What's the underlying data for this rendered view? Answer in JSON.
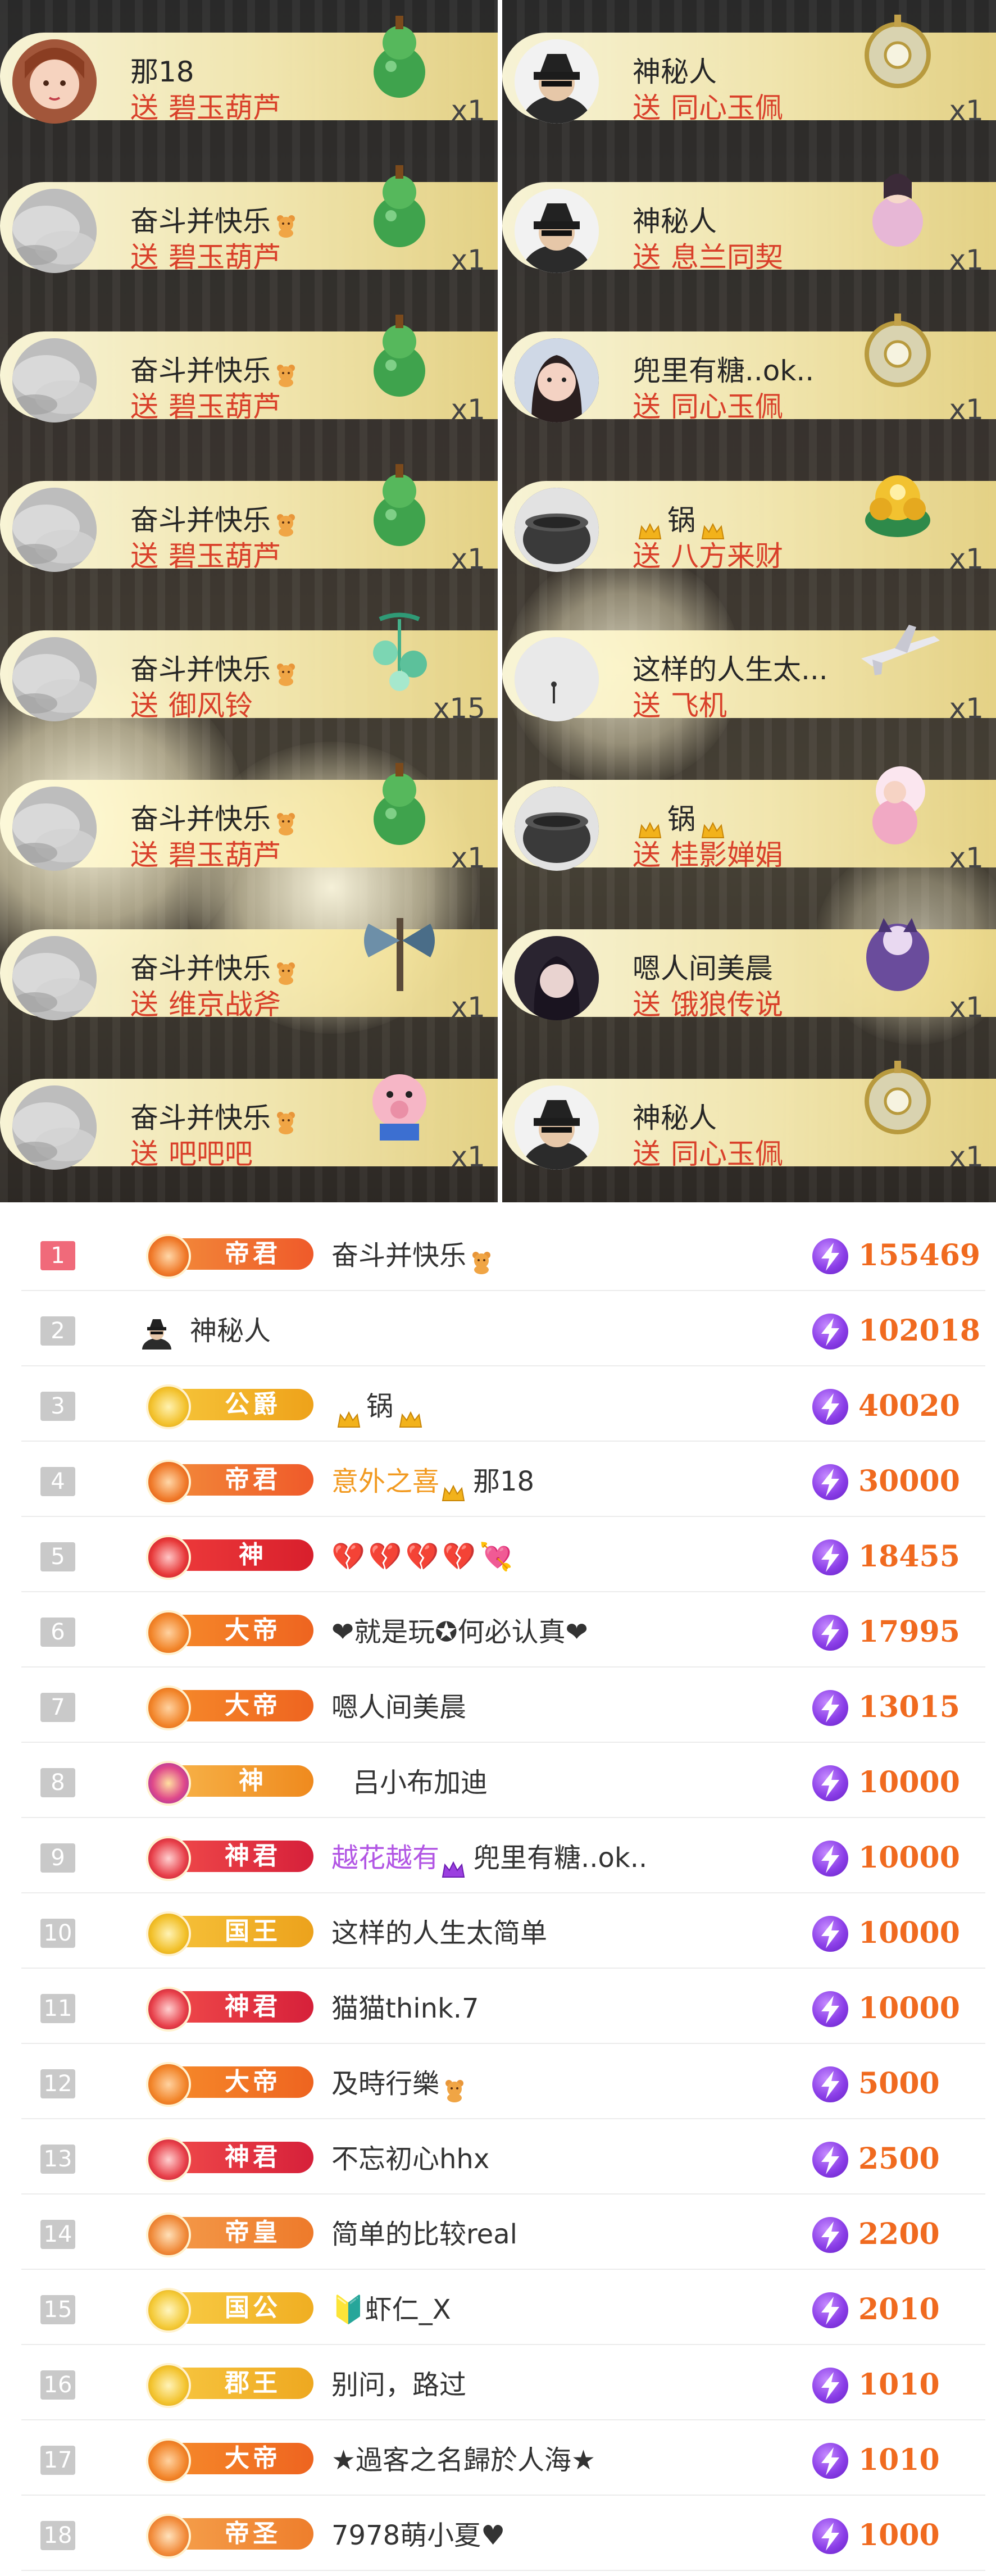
{
  "gift_feed": {
    "send_word": "送",
    "left": [
      {
        "name": "那18",
        "gift": "碧玉葫芦",
        "count": "x1",
        "avatar": "girl",
        "icon": "jade-gourd-icon",
        "bear": false
      },
      {
        "name": "奋斗并快乐",
        "gift": "碧玉葫芦",
        "count": "x1",
        "avatar": "mist",
        "icon": "jade-gourd-icon",
        "bear": true
      },
      {
        "name": "奋斗并快乐",
        "gift": "碧玉葫芦",
        "count": "x1",
        "avatar": "mist",
        "icon": "jade-gourd-icon",
        "bear": true
      },
      {
        "name": "奋斗并快乐",
        "gift": "碧玉葫芦",
        "count": "x1",
        "avatar": "mist",
        "icon": "jade-gourd-icon",
        "bear": true
      },
      {
        "name": "奋斗并快乐",
        "gift": "御风铃",
        "count": "x15",
        "avatar": "mist",
        "icon": "wind-chime-icon",
        "bear": true
      },
      {
        "name": "奋斗并快乐",
        "gift": "碧玉葫芦",
        "count": "x1",
        "avatar": "mist",
        "icon": "jade-gourd-icon",
        "bear": true
      },
      {
        "name": "奋斗并快乐",
        "gift": "维京战斧",
        "count": "x1",
        "avatar": "mist",
        "icon": "viking-axe-icon",
        "bear": true
      },
      {
        "name": "奋斗并快乐",
        "gift": "吧吧吧",
        "count": "x1",
        "avatar": "mist",
        "icon": "cartoon-pig-icon",
        "bear": true
      }
    ],
    "right": [
      {
        "name": "神秘人",
        "gift": "同心玉佩",
        "count": "x1",
        "avatar": "spy",
        "icon": "jade-pendant-icon",
        "crowns": false
      },
      {
        "name": "神秘人",
        "gift": "息兰同契",
        "count": "x1",
        "avatar": "spy",
        "icon": "fairy-lady-icon",
        "crowns": false
      },
      {
        "name": "兜里有糖..ok..",
        "gift": "同心玉佩",
        "count": "x1",
        "avatar": "lady",
        "icon": "jade-pendant-icon",
        "crowns": false
      },
      {
        "name": "锅",
        "gift": "八方来财",
        "count": "x1",
        "avatar": "pot",
        "icon": "gold-treasure-icon",
        "crowns": true
      },
      {
        "name": "这样的人生太...",
        "gift": "飞机",
        "count": "x1",
        "avatar": "fog",
        "icon": "airplane-icon",
        "crowns": false
      },
      {
        "name": "锅",
        "gift": "桂影婵娟",
        "count": "x1",
        "avatar": "pot",
        "icon": "moon-fairy-icon",
        "crowns": true
      },
      {
        "name": "嗯人间美晨",
        "gift": "饿狼传说",
        "count": "x1",
        "avatar": "dark",
        "icon": "wolf-legend-icon",
        "crowns": false
      },
      {
        "name": "神秘人",
        "gift": "同心玉佩",
        "count": "x1",
        "avatar": "spy",
        "icon": "jade-pendant-icon",
        "crowns": false
      }
    ]
  },
  "leaderboard": {
    "rows": [
      {
        "rank": "1",
        "badge": "帝君",
        "badge_style": "dijun",
        "name": "奋斗并快乐",
        "name_prefix": "",
        "score": "155469",
        "suffix": "bear"
      },
      {
        "rank": "2",
        "badge": "",
        "badge_style": "none",
        "name": "神秘人",
        "name_prefix": "",
        "score": "102018",
        "suffix": "spy"
      },
      {
        "rank": "3",
        "badge": "公爵",
        "badge_style": "gongjue",
        "name": "锅",
        "name_prefix": "",
        "score": "40020",
        "suffix": "crowns"
      },
      {
        "rank": "4",
        "badge": "帝君",
        "badge_style": "dijun",
        "name": "那18",
        "name_prefix": "意外之喜",
        "score": "30000",
        "suffix": "prefix-crown"
      },
      {
        "rank": "5",
        "badge": "神",
        "badge_style": "shen-red",
        "name": "💔💔💔💔💘",
        "name_prefix": "",
        "score": "18455",
        "suffix": "hearts"
      },
      {
        "rank": "6",
        "badge": "大帝",
        "badge_style": "dadi",
        "name": "❤就是玩✪何必认真❤",
        "name_prefix": "",
        "score": "17995",
        "suffix": ""
      },
      {
        "rank": "7",
        "badge": "大帝",
        "badge_style": "dadi",
        "name": "嗯人间美晨",
        "name_prefix": "",
        "score": "13015",
        "suffix": ""
      },
      {
        "rank": "8",
        "badge": "神",
        "badge_style": "shen-gold",
        "name": "吕小布加迪",
        "name_prefix": "",
        "score": "10000",
        "suffix": ""
      },
      {
        "rank": "9",
        "badge": "神君",
        "badge_style": "shenjun",
        "name": "兜里有糖..ok..",
        "name_prefix": "越花越有",
        "score": "10000",
        "suffix": "prefix-crown-purple"
      },
      {
        "rank": "10",
        "badge": "国王",
        "badge_style": "guowang",
        "name": "这样的人生太简单",
        "name_prefix": "",
        "score": "10000",
        "suffix": ""
      },
      {
        "rank": "11",
        "badge": "神君",
        "badge_style": "shenjun",
        "name": "猫猫think.7",
        "name_prefix": "",
        "score": "10000",
        "suffix": ""
      },
      {
        "rank": "12",
        "badge": "大帝",
        "badge_style": "dadi",
        "name": "及時行樂",
        "name_prefix": "",
        "score": "5000",
        "suffix": "bear"
      },
      {
        "rank": "13",
        "badge": "神君",
        "badge_style": "shenjun",
        "name": "不忘初心hhx",
        "name_prefix": "",
        "score": "2500",
        "suffix": ""
      },
      {
        "rank": "14",
        "badge": "帝皇",
        "badge_style": "dihuang",
        "name": "简单的比较real",
        "name_prefix": "",
        "score": "2200",
        "suffix": ""
      },
      {
        "rank": "15",
        "badge": "国公",
        "badge_style": "guogong",
        "name": "🔰虾仁_X",
        "name_prefix": "",
        "score": "2010",
        "suffix": ""
      },
      {
        "rank": "16",
        "badge": "郡王",
        "badge_style": "junwang",
        "name": "别问，路过",
        "name_prefix": "",
        "score": "1010",
        "suffix": ""
      },
      {
        "rank": "17",
        "badge": "大帝",
        "badge_style": "dadi",
        "name": "★過客之名歸於人海★",
        "name_prefix": "",
        "score": "1010",
        "suffix": ""
      },
      {
        "rank": "18",
        "badge": "帝圣",
        "badge_style": "disheng",
        "name": "7978萌小夏♥",
        "name_prefix": "",
        "score": "1000",
        "suffix": ""
      }
    ]
  },
  "colors": {
    "score": "#f06a1f",
    "rank_first": "#f06a7a",
    "rank_other": "#c9c9c9",
    "gift_action": "#d9402a",
    "bolt": "#8b3ee8"
  }
}
